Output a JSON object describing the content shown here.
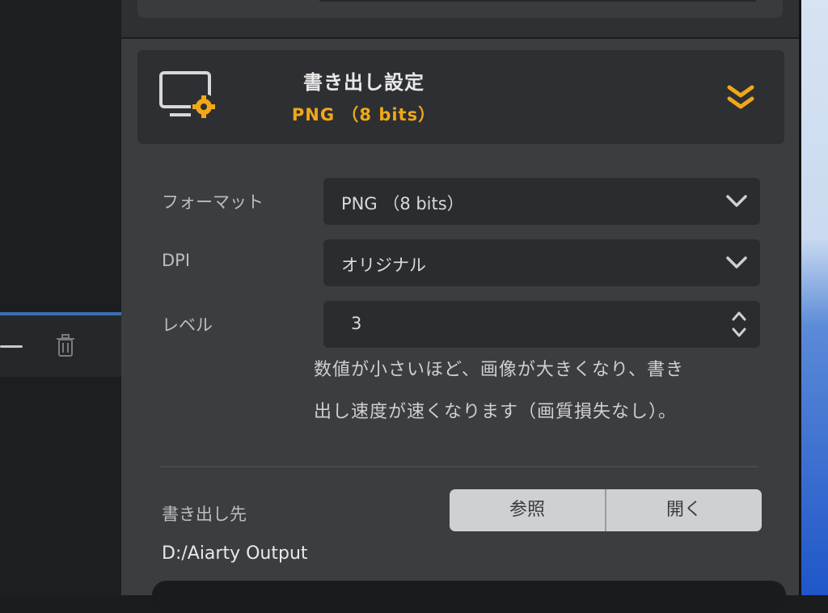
{
  "export_settings": {
    "title": "書き出し設定",
    "summary": "PNG （8 bits）"
  },
  "fields": {
    "format": {
      "label": "フォーマット",
      "value": "PNG （8 bits）"
    },
    "dpi": {
      "label": "DPI",
      "value": "オリジナル"
    },
    "level": {
      "label": "レベル",
      "value": "3"
    }
  },
  "level_note": {
    "line1": "数値が小さいほど、画像が大きくなり、書き",
    "line2": "出し速度が速くなります（画質損失なし）。"
  },
  "output": {
    "label": "書き出し先",
    "browse_label": "参照",
    "open_label": "開く",
    "path": "D:/Aiarty Output"
  },
  "colors": {
    "accent": "#f0a818",
    "panel": "#3c3d40",
    "field": "#2b2c2f"
  },
  "icons": {
    "header": "monitor-gear-icon",
    "collapse": "double-chevron-down-icon",
    "dropdown": "chevron-down-icon",
    "spinner": "spinner-arrows-icon",
    "trash": "trash-icon"
  }
}
